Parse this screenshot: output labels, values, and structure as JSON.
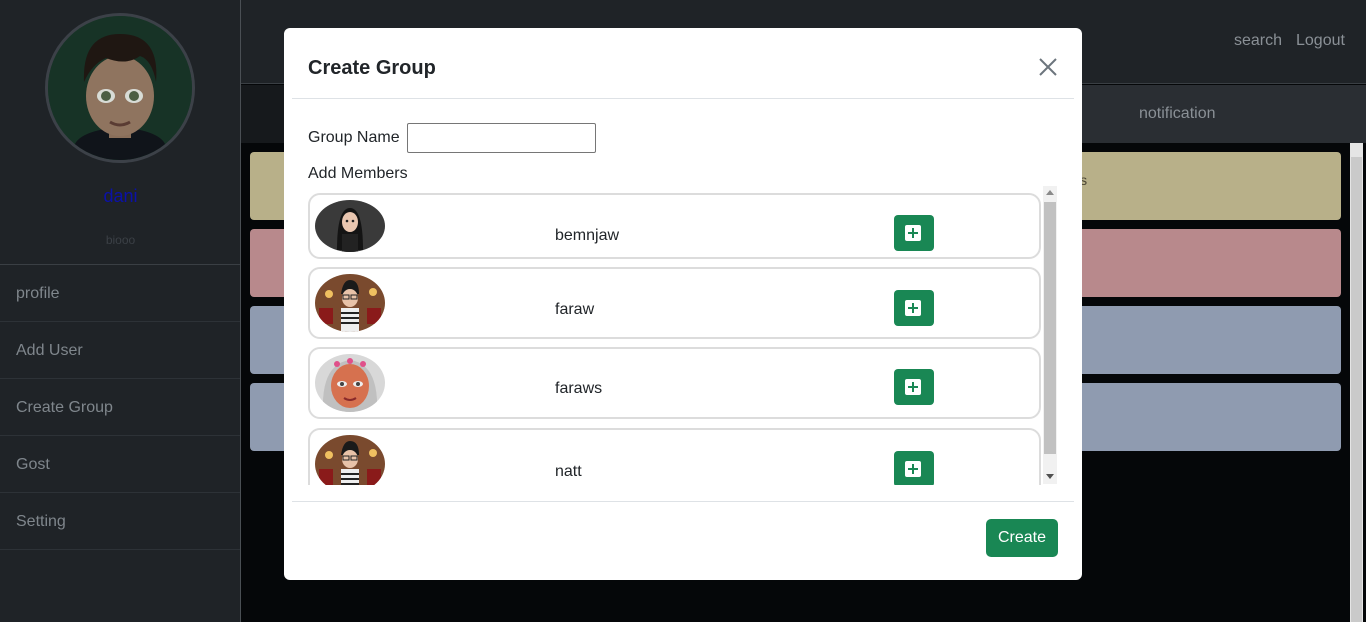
{
  "sidebar": {
    "user_name": "dani",
    "user_bio": "biooo",
    "items": [
      {
        "label": "profile"
      },
      {
        "label": "Add User"
      },
      {
        "label": "Create Group"
      },
      {
        "label": "Gost"
      },
      {
        "label": "Setting"
      }
    ]
  },
  "header": {
    "search_label": "search",
    "logout_label": "Logout",
    "notification_label": "notification"
  },
  "background_cards": [
    {
      "text": "Us",
      "color": "#b8b089"
    },
    {
      "text": "",
      "color": "#b8898c"
    },
    {
      "text": "",
      "color": "#8f9bb0"
    },
    {
      "text": "",
      "color": "#8f9bb0"
    }
  ],
  "modal": {
    "title": "Create Group",
    "group_name_label": "Group Name",
    "group_name_value": "",
    "add_members_label": "Add Members",
    "members": [
      {
        "name": "bemnjaw",
        "avatar_icon": "avatar-woman-dark-hair-icon"
      },
      {
        "name": "faraw",
        "avatar_icon": "avatar-man-glasses-icon"
      },
      {
        "name": "faraws",
        "avatar_icon": "avatar-woman-flower-crown-icon"
      },
      {
        "name": "natt",
        "avatar_icon": "avatar-man-glasses-icon"
      }
    ],
    "create_label": "Create"
  },
  "colors": {
    "accent_green": "#198754",
    "user_name_blue": "#0b11a8"
  }
}
